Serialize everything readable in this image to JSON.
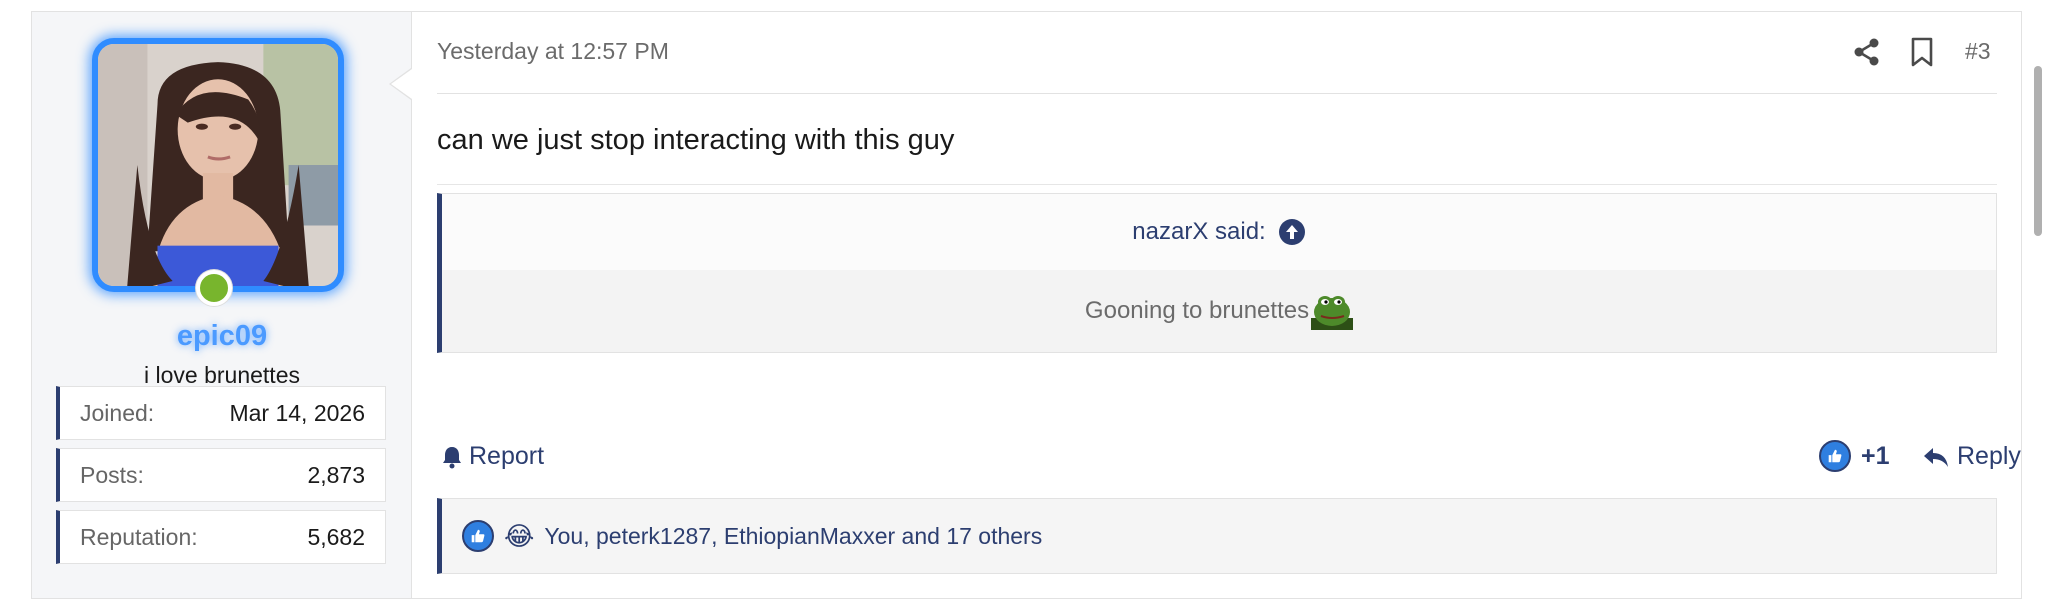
{
  "user": {
    "username": "epic09",
    "user_title": "i love brunettes",
    "status": "online",
    "stats": [
      {
        "label": "Joined:",
        "value": "Mar 14, 2026"
      },
      {
        "label": "Posts:",
        "value": "2,873"
      },
      {
        "label": "Reputation:",
        "value": "5,682"
      }
    ]
  },
  "post": {
    "timestamp": "Yesterday at 12:57 PM",
    "number": "#3",
    "message": "can we just stop interacting with this guy",
    "quote": {
      "author_line": "nazarX said:",
      "text": "Gooning to brunettes"
    },
    "actions": {
      "report": "Report",
      "reaction_count": "+1",
      "reply": "Reply"
    },
    "reactions_summary": "You, peterk1287, EthiopianMaxxer and 17 others"
  },
  "icons": {
    "share": "share-icon",
    "bookmark": "bookmark-icon",
    "report": "bell-icon",
    "reply": "reply-arrow-icon",
    "quote_jump": "arrow-up-circle-icon",
    "like": "thumbs-up-icon",
    "laugh": "laughing-tears-emoji"
  },
  "colors": {
    "accent": "#2c3e70",
    "username_glow": "#4b9aff",
    "online": "#78b52d"
  }
}
